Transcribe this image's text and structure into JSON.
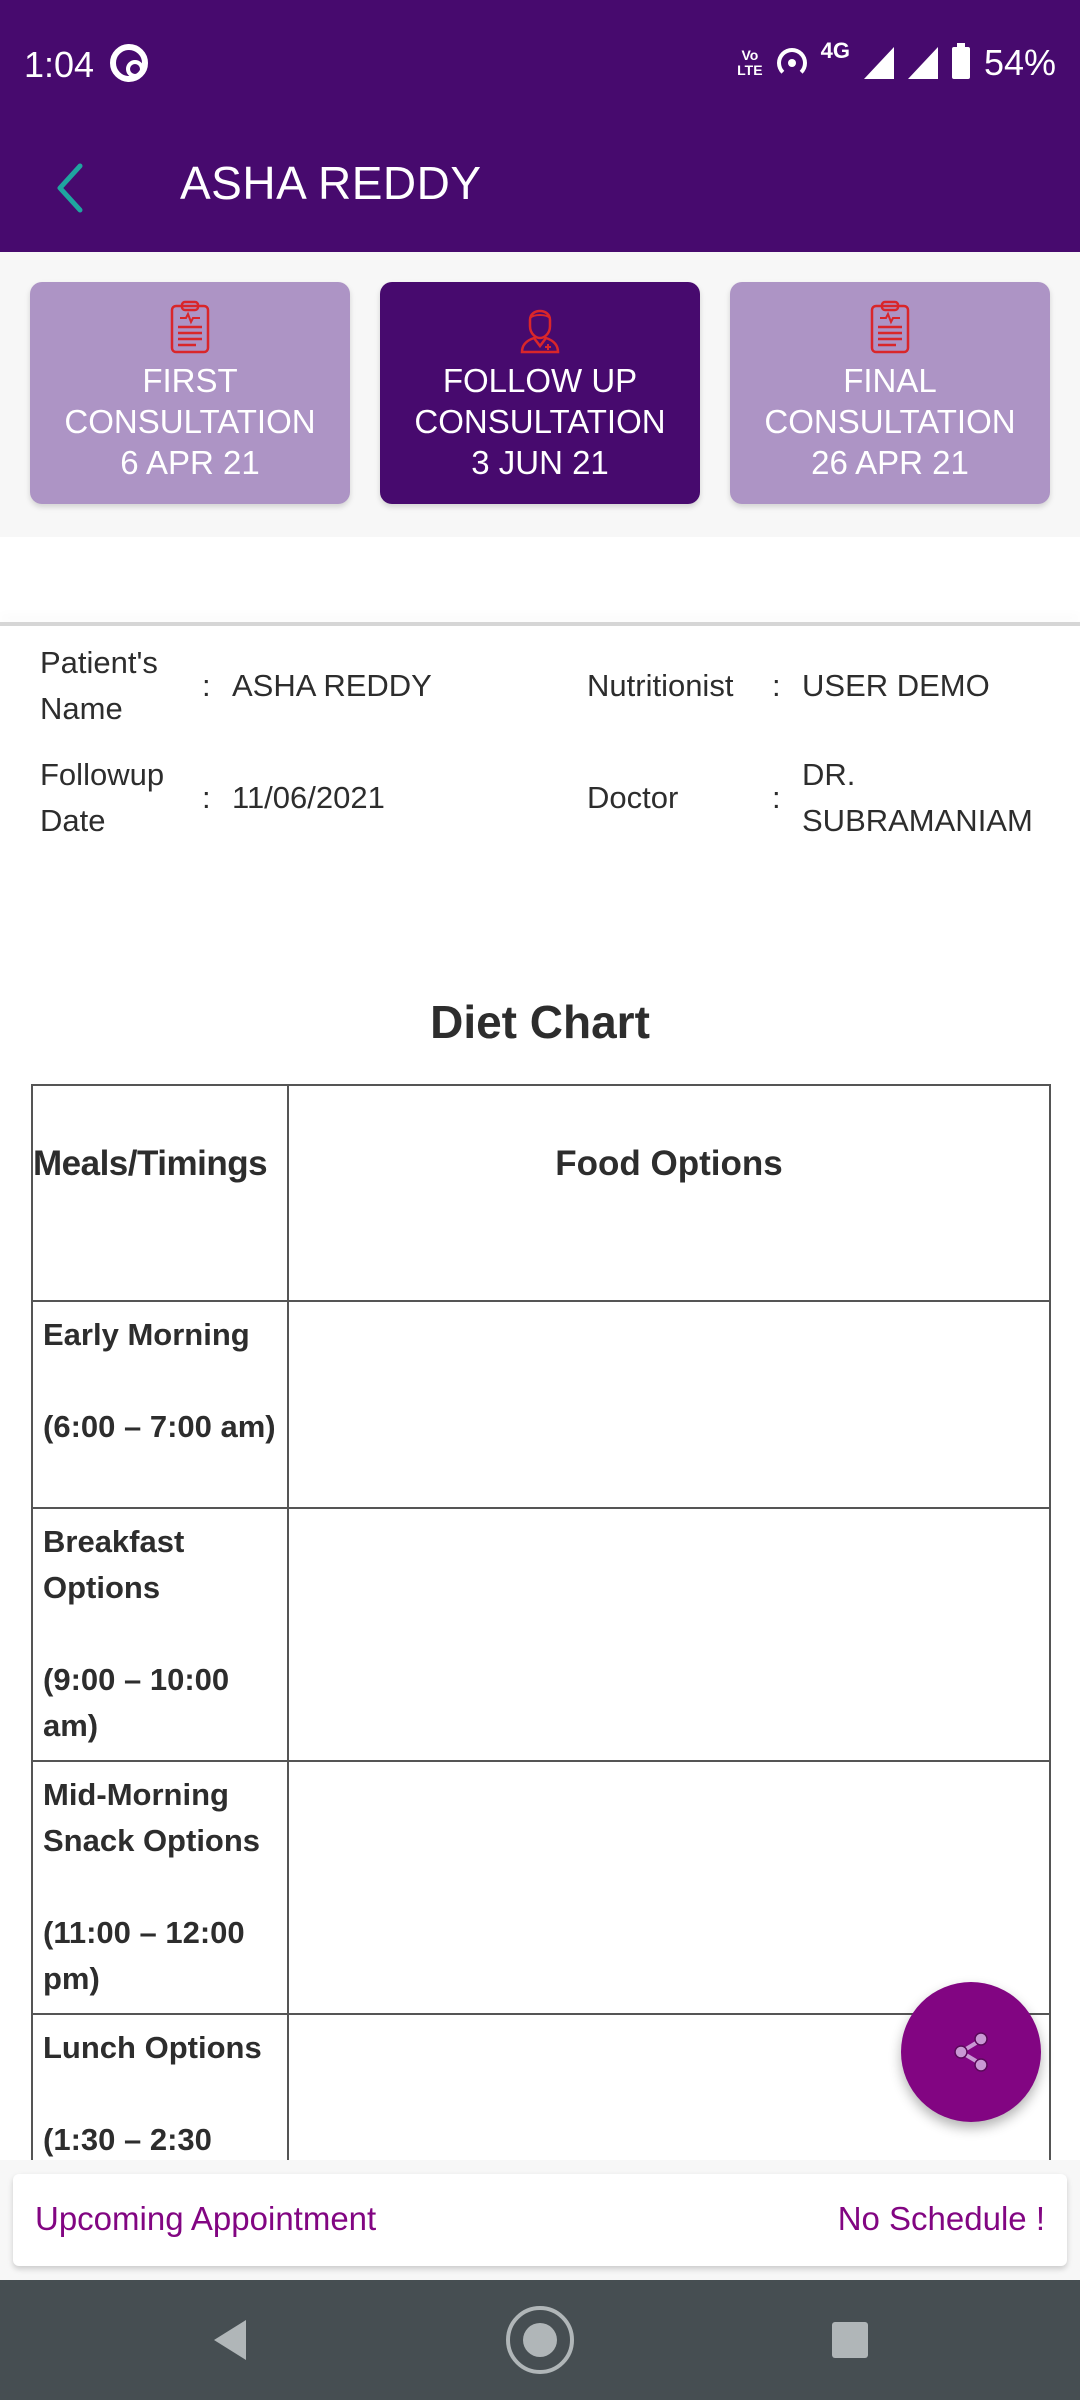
{
  "status_bar": {
    "time": "1:04",
    "network_volte": "Vo LTE",
    "network_type": "4G",
    "battery": "54%",
    "icons": [
      "data-saver-icon",
      "volte-icon",
      "hotspot-icon",
      "signal-icon",
      "signal-icon",
      "battery-charging-icon"
    ]
  },
  "app_bar": {
    "title": "ASHA REDDY",
    "back_icon": "chevron-left-icon"
  },
  "consultation_tabs": [
    {
      "line1": "FIRST",
      "line2": "CONSULTATION",
      "date": "6 APR 21",
      "icon": "clipboard-icon",
      "active": false
    },
    {
      "line1": "FOLLOW UP",
      "line2": "CONSULTATION",
      "date": "3 JUN 21",
      "icon": "doctor-icon",
      "active": true
    },
    {
      "line1": "FINAL",
      "line2": "CONSULTATION",
      "date": "26 APR 21",
      "icon": "clipboard-icon",
      "active": false
    }
  ],
  "patient_info": {
    "patient_name_label": "Patient's Name",
    "patient_name": "ASHA REDDY",
    "nutritionist_label": "Nutritionist",
    "nutritionist": "USER DEMO",
    "followup_date_label": "Followup Date",
    "followup_date": "11/06/2021",
    "doctor_label": "Doctor",
    "doctor": "DR. SUBRAMANIAM",
    "separator": ":"
  },
  "diet_chart": {
    "title": "Diet Chart",
    "columns": [
      "Meals/Timings",
      "Food Options"
    ],
    "rows": [
      {
        "meal": "Early Morning",
        "time": "(6:00 – 7:00 am)",
        "food": ""
      },
      {
        "meal": "Breakfast Options",
        "time": "(9:00 – 10:00 am)",
        "food": ""
      },
      {
        "meal": "Mid-Morning Snack Options",
        "time": "(11:00 – 12:00 pm)",
        "food": ""
      },
      {
        "meal": "Lunch Options",
        "time": "(1:30 – 2:30",
        "food": ""
      }
    ]
  },
  "fab": {
    "icon": "share-icon"
  },
  "upcoming": {
    "label": "Upcoming Appointment",
    "value": "No Schedule !"
  },
  "nav_bar": {
    "buttons": [
      "back-icon",
      "home-icon",
      "recents-icon"
    ]
  },
  "colors": {
    "primary": "#470a6e",
    "tab_inactive": "#ad94c5",
    "accent": "#820582",
    "icon_red": "#d9262a",
    "back_teal": "#1fa5a0"
  }
}
